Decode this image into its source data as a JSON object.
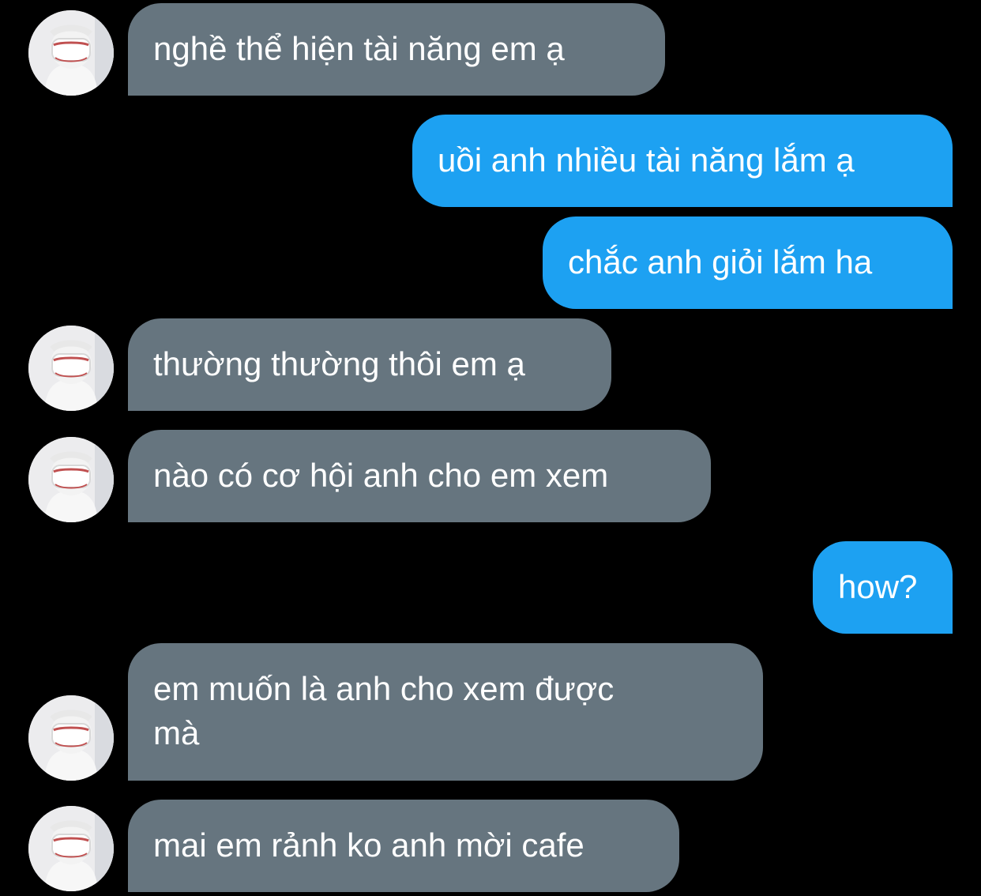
{
  "messages": [
    {
      "side": "incoming",
      "text": "nghề thể hiện tài năng em ạ"
    },
    {
      "side": "outgoing",
      "text": "uồi anh nhiều tài năng lắm ạ"
    },
    {
      "side": "outgoing",
      "text": "chắc anh giỏi lắm ha"
    },
    {
      "side": "incoming",
      "text": "thường thường thôi em ạ"
    },
    {
      "side": "incoming",
      "text": "nào có cơ hội anh cho em xem"
    },
    {
      "side": "outgoing",
      "text": "how?"
    },
    {
      "side": "incoming",
      "text": "em muốn là anh cho xem được\nmà"
    },
    {
      "side": "incoming",
      "text": "mai em rảnh ko anh mời cafe"
    }
  ],
  "colors": {
    "background": "#000000",
    "incoming_bubble": "#66757f",
    "outgoing_bubble": "#1da1f2",
    "text": "#ffffff"
  },
  "icons": {
    "avatar": "profile-photo-masked-person"
  }
}
